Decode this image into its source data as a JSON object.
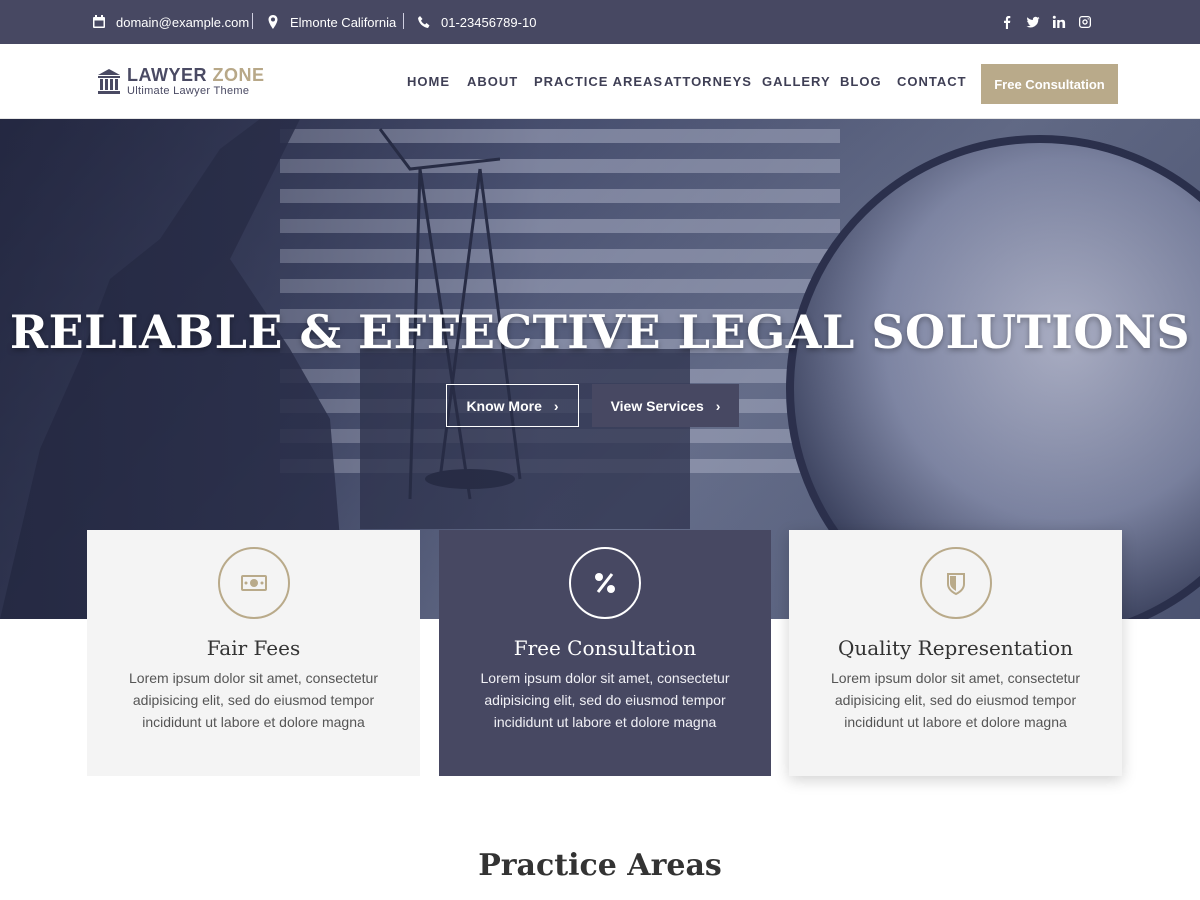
{
  "topbar": {
    "email": "domain@example.com",
    "location": "Elmonte California",
    "phone": "01-23456789-10",
    "socials": [
      "facebook",
      "twitter",
      "linkedin",
      "instagram"
    ]
  },
  "logo": {
    "word1": "LAWYER",
    "word2": "ZONE",
    "tagline": "Ultimate Lawyer Theme"
  },
  "nav": {
    "items": [
      "HOME",
      "ABOUT",
      "PRACTICE AREAS",
      "ATTORNEYS",
      "GALLERY",
      "BLOG",
      "CONTACT"
    ],
    "cta": "Free Consultation"
  },
  "hero": {
    "title": "RELIABLE & EFFECTIVE LEGAL SOLUTIONS",
    "btn_know": "Know More",
    "btn_services": "View Services"
  },
  "cards": [
    {
      "title": "Fair Fees",
      "text": "Lorem ipsum dolor sit amet, consectetur adipisicing elit, sed do eiusmod tempor incididunt ut labore et dolore magna",
      "icon": "money-icon"
    },
    {
      "title": "Free Consultation",
      "text": "Lorem ipsum dolor sit amet, consectetur adipisicing elit, sed do eiusmod tempor incididunt ut labore et dolore magna",
      "icon": "percent-icon"
    },
    {
      "title": "Quality Representation",
      "text": "Lorem ipsum dolor sit amet, consectetur adipisicing elit, sed do eiusmod tempor incididunt ut labore et dolore magna",
      "icon": "shield-icon"
    }
  ],
  "section": {
    "title": "Practice Areas"
  },
  "colors": {
    "primary": "#474862",
    "accent": "#b9aa8a"
  }
}
